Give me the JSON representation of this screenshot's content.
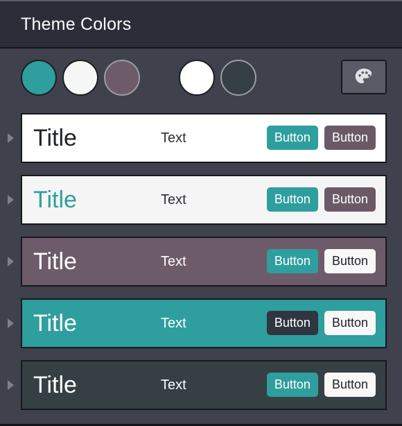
{
  "window": {
    "background": "#3f424d"
  },
  "header": {
    "title": "Theme Colors",
    "background": "#2b2d38",
    "text_color": "#ffffff"
  },
  "swatch_bar": {
    "swatches": [
      {
        "name": "primary-teal",
        "color": "#2f9e9e",
        "ring": "#1c1d23",
        "gap_before": false
      },
      {
        "name": "light-white",
        "color": "#f7f7f7",
        "ring": "#1c1d23",
        "gap_before": false
      },
      {
        "name": "mauve",
        "color": "#6e5b69",
        "ring": "#9a9da5",
        "gap_before": false
      },
      {
        "name": "pure-white",
        "color": "#ffffff",
        "ring": "#1c1d23",
        "gap_before": true
      },
      {
        "name": "dark-slate",
        "color": "#353f44",
        "ring": "#9a9da5",
        "gap_before": false
      }
    ],
    "palette_button": {
      "icon": "palette-icon",
      "background": "#595c66",
      "icon_color": "#e2e2e4"
    }
  },
  "theme_rows": [
    {
      "expander": "collapsed-triangle",
      "background": "#ffffff",
      "title": "Title",
      "title_color": "#21232b",
      "text": "Text",
      "text_color": "#2c2f38",
      "buttons": [
        {
          "label": "Button",
          "background": "#2f9e9e",
          "color": "#ffffff"
        },
        {
          "label": "Button",
          "background": "#6b5a66",
          "color": "#ffffff"
        }
      ]
    },
    {
      "expander": "collapsed-triangle",
      "background": "#f5f5f5",
      "title": "Title",
      "title_color": "#2f9e9e",
      "text": "Text",
      "text_color": "#2c2f38",
      "buttons": [
        {
          "label": "Button",
          "background": "#2f9e9e",
          "color": "#ffffff"
        },
        {
          "label": "Button",
          "background": "#6b5a66",
          "color": "#ffffff"
        }
      ]
    },
    {
      "expander": "collapsed-triangle",
      "background": "#6e5b69",
      "title": "Title",
      "title_color": "#ffffff",
      "text": "Text",
      "text_color": "#ffffff",
      "buttons": [
        {
          "label": "Button",
          "background": "#2f9e9e",
          "color": "#ffffff"
        },
        {
          "label": "Button",
          "background": "#f8f8f8",
          "color": "#21232b"
        }
      ]
    },
    {
      "expander": "collapsed-triangle",
      "background": "#2f9e9e",
      "title": "Title",
      "title_color": "#ffffff",
      "text": "Text",
      "text_color": "#ffffff",
      "buttons": [
        {
          "label": "Button",
          "background": "#2f3640",
          "color": "#ffffff"
        },
        {
          "label": "Button",
          "background": "#f8f8f8",
          "color": "#21232b"
        }
      ]
    },
    {
      "expander": "collapsed-triangle",
      "background": "#353f44",
      "title": "Title",
      "title_color": "#ffffff",
      "text": "Text",
      "text_color": "#ffffff",
      "buttons": [
        {
          "label": "Button",
          "background": "#2f9e9e",
          "color": "#ffffff"
        },
        {
          "label": "Button",
          "background": "#f8f8f8",
          "color": "#21232b"
        }
      ]
    }
  ]
}
